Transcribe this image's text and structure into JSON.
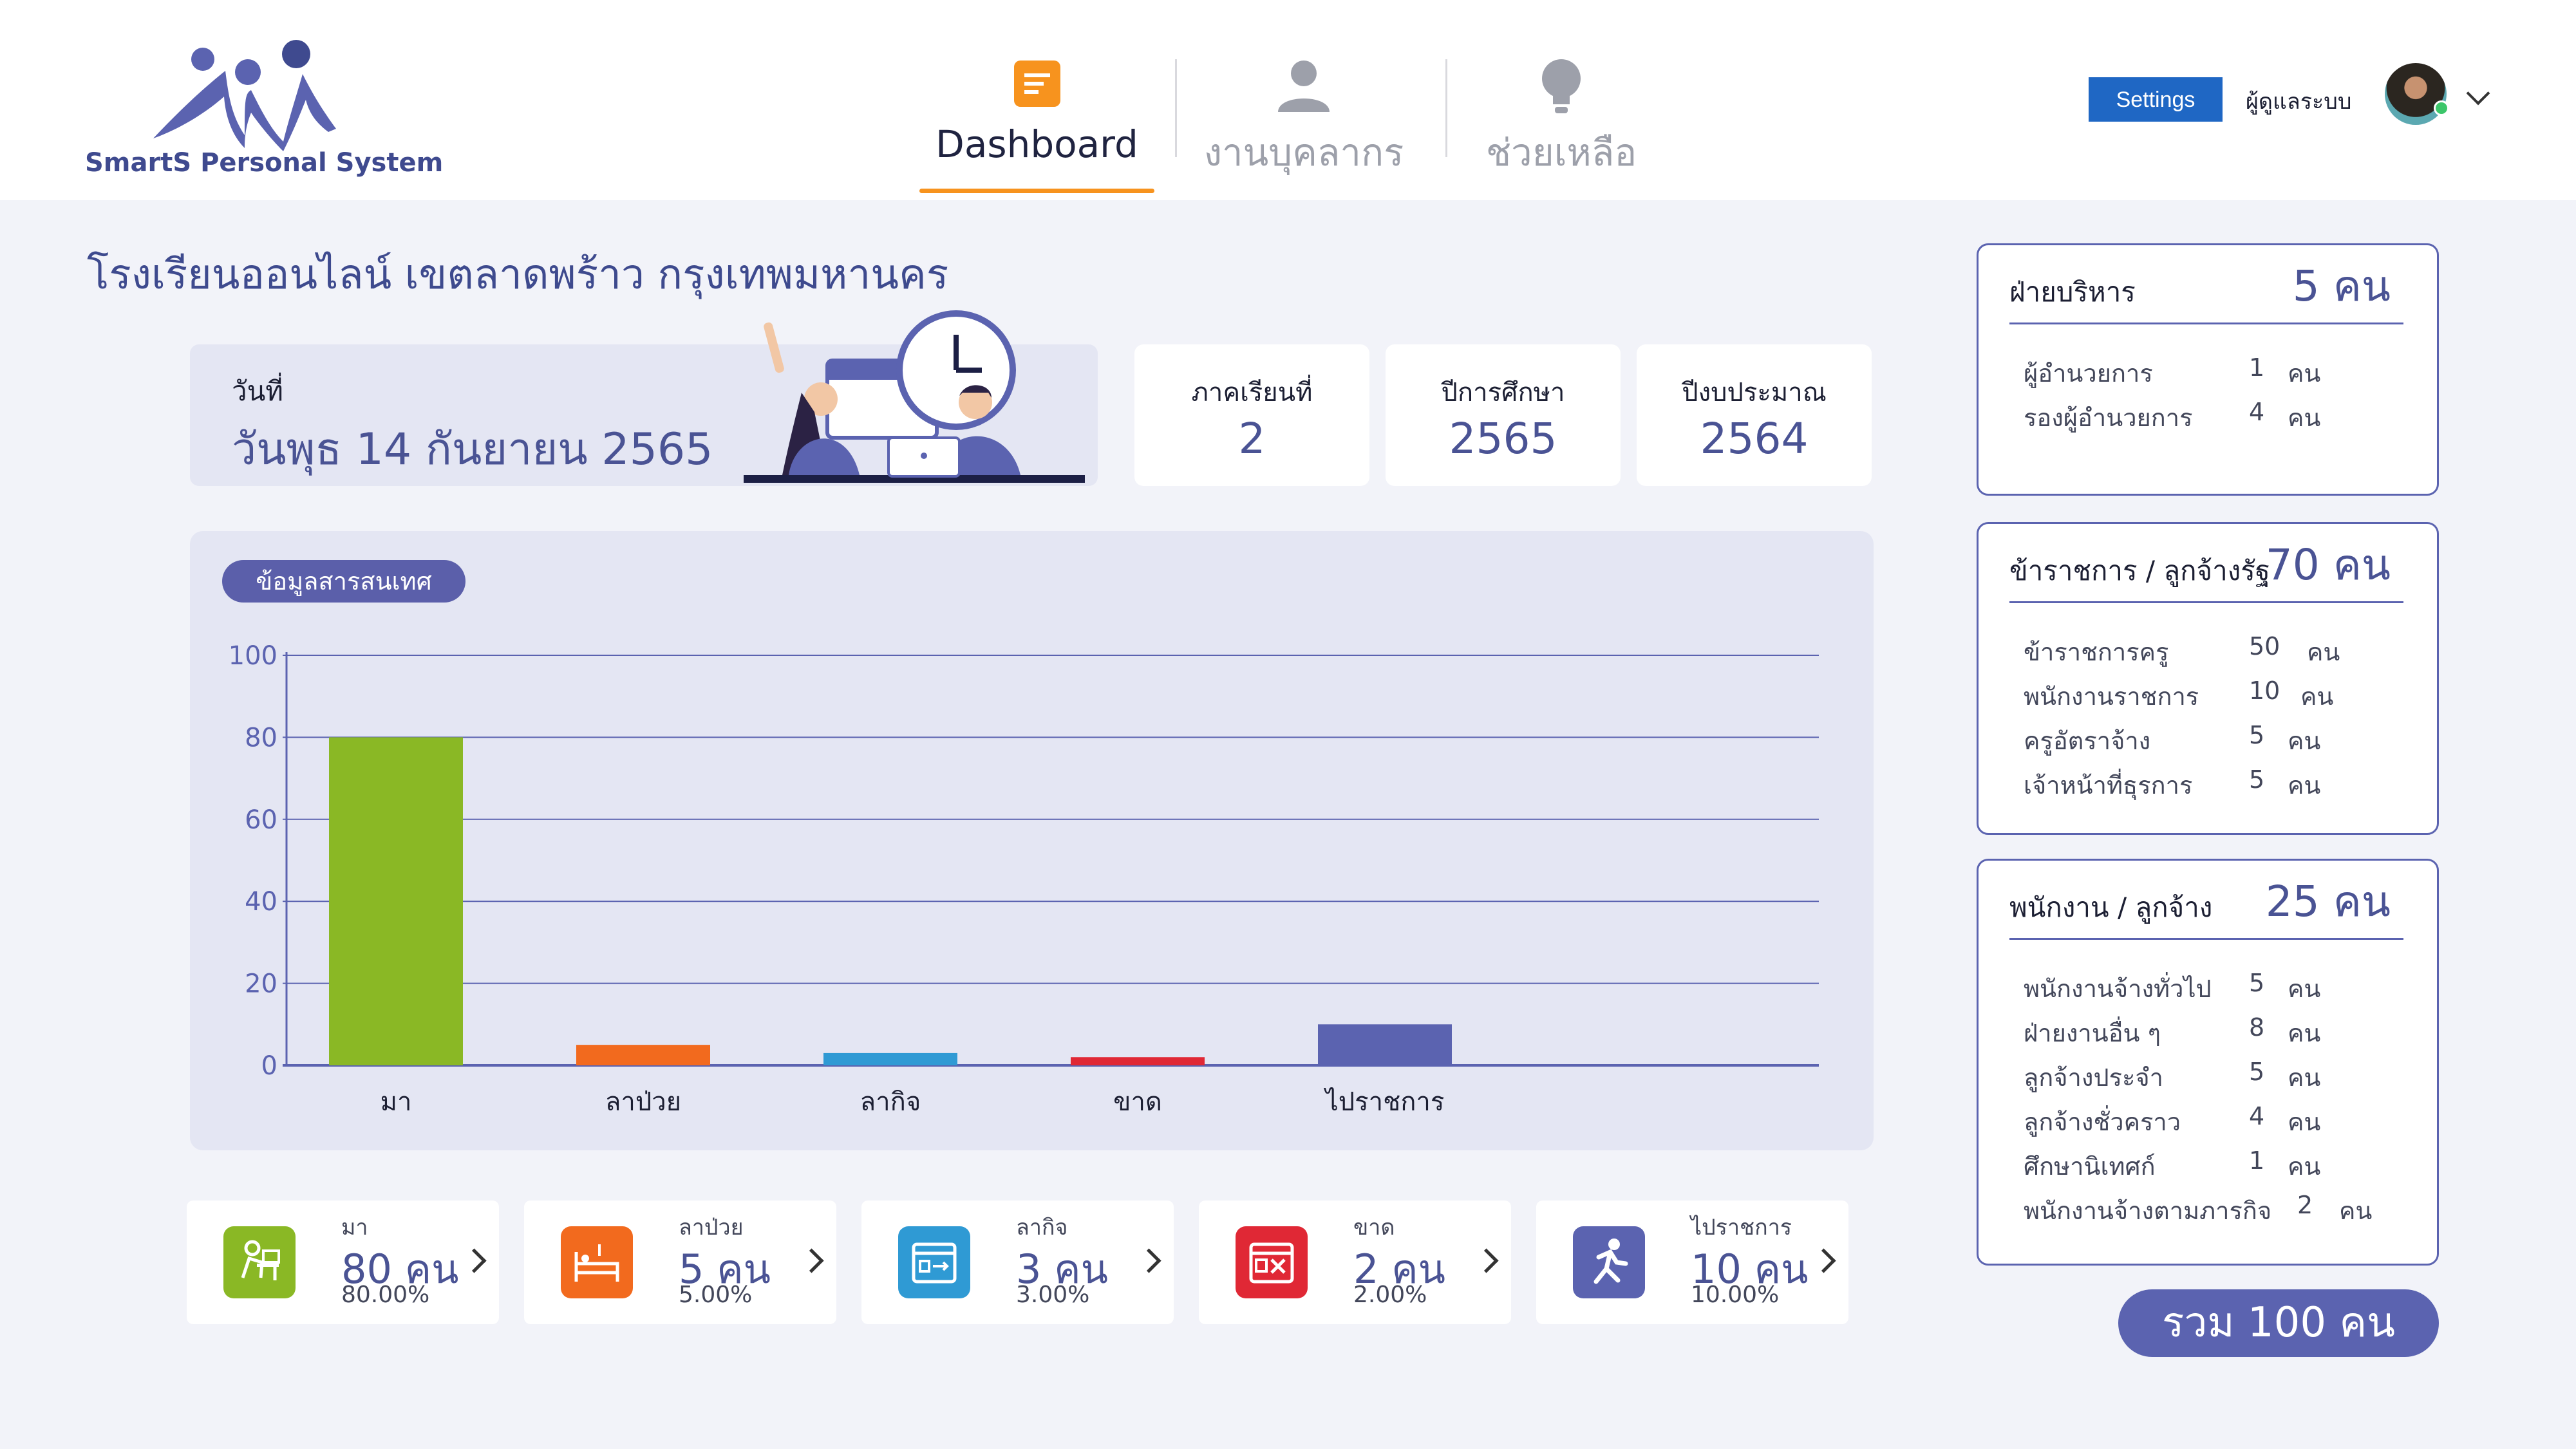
{
  "app": {
    "logo_text": "SmartS Personal System"
  },
  "nav": [
    {
      "label": "Dashboard",
      "icon": "document-icon",
      "active": true
    },
    {
      "label": "งานบุคลากร",
      "icon": "person-icon",
      "active": false
    },
    {
      "label": "ช่วยเหลือ",
      "icon": "lightbulb-icon",
      "active": false
    }
  ],
  "header": {
    "settings_label": "Settings",
    "user_name": "ผู้ดูแลระบบ"
  },
  "page": {
    "title": "โรงเรียนออนไลน์ เขตลาดพร้าว กรุงเทพมหานคร"
  },
  "date": {
    "label": "วันที่",
    "value": "วันพุธ 14 กันยายน 2565"
  },
  "info_cards": [
    {
      "label": "ภาคเรียนที่",
      "value": "2"
    },
    {
      "label": "ปีการศึกษา",
      "value": "2565"
    },
    {
      "label": "ปีงบประมาณ",
      "value": "2564"
    }
  ],
  "chart_pill": "ข้อมูลสารสนเทศ",
  "chart_data": {
    "type": "bar",
    "categories": [
      "มา",
      "ลาป่วย",
      "ลากิจ",
      "ขาด",
      "ไปราชการ"
    ],
    "values": [
      80,
      5,
      3,
      2,
      10
    ],
    "colors": [
      "#8ab825",
      "#f26a1e",
      "#2f9ad4",
      "#e02835",
      "#5b63b0"
    ],
    "ylim": [
      0,
      100
    ],
    "yticks": [
      0,
      20,
      40,
      60,
      80,
      100
    ],
    "grid": true
  },
  "stats": [
    {
      "title": "มา",
      "value": "80 คน",
      "percent": "80.00%",
      "color": "#8ab825",
      "icon": "desk-worker-icon"
    },
    {
      "title": "ลาป่วย",
      "value": "5 คน",
      "percent": "5.00%",
      "color": "#f26a1e",
      "icon": "sick-bed-icon"
    },
    {
      "title": "ลากิจ",
      "value": "3 คน",
      "percent": "3.00%",
      "color": "#2f9ad4",
      "icon": "calendar-leave-icon"
    },
    {
      "title": "ขาด",
      "value": "2 คน",
      "percent": "2.00%",
      "color": "#e02835",
      "icon": "calendar-absent-icon"
    },
    {
      "title": "ไปราชการ",
      "value": "10 คน",
      "percent": "10.00%",
      "color": "#5b63b0",
      "icon": "running-person-icon"
    }
  ],
  "groups": [
    {
      "name": "ฝ่ายบริหาร",
      "total": "5 คน",
      "rows": [
        {
          "label": "ผู้อำนวยการ",
          "count": "1",
          "unit": "คน"
        },
        {
          "label": "รองผู้อำนวยการ",
          "count": "4",
          "unit": "คน"
        }
      ]
    },
    {
      "name": "ข้าราชการ / ลูกจ้างรัฐ",
      "total": "70 คน",
      "rows": [
        {
          "label": "ข้าราชการครู",
          "count": "50",
          "unit": "คน"
        },
        {
          "label": "พนักงานราชการ",
          "count": "10",
          "unit": "คน"
        },
        {
          "label": "ครูอัตราจ้าง",
          "count": "5",
          "unit": "คน"
        },
        {
          "label": "เจ้าหน้าที่ธุรการ",
          "count": "5",
          "unit": "คน"
        }
      ]
    },
    {
      "name": "พนักงาน / ลูกจ้าง",
      "total": "25 คน",
      "rows": [
        {
          "label": "พนักงานจ้างทั่วไป",
          "count": "5",
          "unit": "คน"
        },
        {
          "label": "ฝ่ายงานอื่น ๆ",
          "count": "8",
          "unit": "คน"
        },
        {
          "label": "ลูกจ้างประจำ",
          "count": "5",
          "unit": "คน"
        },
        {
          "label": "ลูกจ้างชั่วคราว",
          "count": "4",
          "unit": "คน"
        },
        {
          "label": "ศึกษานิเทศก์",
          "count": "1",
          "unit": "คน"
        },
        {
          "label": "พนักงานจ้างตามภารกิจ",
          "count": "2",
          "unit": "คน"
        }
      ]
    }
  ],
  "total": "รวม 100 คน"
}
